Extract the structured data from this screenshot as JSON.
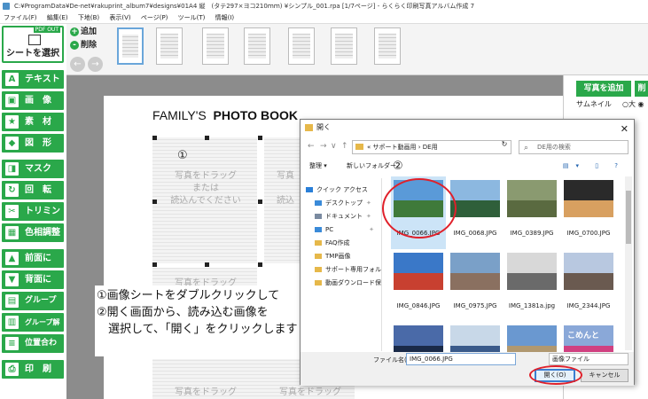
{
  "window": {
    "title": "C:¥ProgramData¥De-net¥rakuprint_album7¥designs¥01A4 縦　(タテ297×ヨコ210ｍｍ) ¥シンプル_001.rpa [1/7ページ] - らくらく印刷写真アルバム作成 7"
  },
  "menu": [
    "ファイル(F)",
    "編集(E)",
    "下地(B)",
    "表示(V)",
    "ページ(P)",
    "ツール(T)",
    "情報(I)"
  ],
  "left_tools": {
    "sheet_badge": "PDF OUT",
    "sheet_label": "シートを選択",
    "items": [
      {
        "label": "テキスト",
        "icon": "A"
      },
      {
        "label": "画　像",
        "icon": "▣"
      },
      {
        "label": "素　材",
        "icon": "★"
      },
      {
        "label": "図　形",
        "icon": "◆"
      },
      {
        "label": "マスク",
        "icon": "◨"
      },
      {
        "label": "回　転",
        "icon": "↻"
      },
      {
        "label": "トリミング",
        "icon": "✂"
      },
      {
        "label": "色相調整",
        "icon": "▦"
      },
      {
        "label": "前面に",
        "icon": "▲"
      },
      {
        "label": "背面に",
        "icon": "▼"
      },
      {
        "label": "グループ化",
        "icon": "▤"
      },
      {
        "label": "グループ解除",
        "icon": "▥"
      },
      {
        "label": "位置合わせ",
        "icon": "≡"
      },
      {
        "label": "印　刷",
        "icon": "⎙"
      }
    ]
  },
  "page_bar": {
    "add_label": "追加",
    "delete_label": "削除",
    "add_icon": "+",
    "delete_icon": "-",
    "prev_icon": "←",
    "next_icon": "→"
  },
  "canvas": {
    "title_regular": "FAMILY'S",
    "title_bold": "PHOTO BOOK",
    "marker_1": "①",
    "placeholder_line1": "写真をドラッグ",
    "placeholder_line2": "または",
    "placeholder_line3": "読込んでください",
    "placeholder_partial2": "写真",
    "placeholder_partial3": "読込",
    "placeholder_drag": "写真をドラッグ"
  },
  "right_panel": {
    "add_photo_label": "写真を追加",
    "partial_label": "削",
    "thumb_size_label": "サムネイル",
    "size_option": "○大 ◉"
  },
  "instructions": {
    "line1": "①画像シートをダブルクリックして",
    "line2": "②開く画面から、読み込む画像を",
    "line3": "　選択して、「開く」をクリックします"
  },
  "dialog": {
    "title": "開く",
    "close_icon": "✕",
    "back_icon": "←",
    "forward_icon": "→",
    "dropdown_icon": "∨",
    "up_icon": "↑",
    "path": "«  サポート動画用  ›  DE用",
    "refresh_icon": "↻",
    "search_icon": "⌕",
    "search_placeholder": "DE用の検索",
    "organize_label": "整理 ▾",
    "new_folder_label": "新しいフォルダー",
    "view_icons": "▤▾ ▯ ?",
    "marker_2": "②",
    "nav": [
      {
        "label": "クイック アクセス",
        "pin": "",
        "color": "#2a7fd8"
      },
      {
        "label": "デスクトップ",
        "pin": "✦",
        "color": "#3a8ad8"
      },
      {
        "label": "ドキュメント",
        "pin": "✦",
        "color": "#7a8aa0"
      },
      {
        "label": "PC",
        "pin": "✦",
        "color": "#3a8ad8"
      },
      {
        "label": "FAQ作成",
        "pin": "",
        "color": "#e6b84a"
      },
      {
        "label": "TMP画像",
        "pin": "",
        "color": "#e6b84a"
      },
      {
        "label": "サポート専用フォル",
        "pin": "",
        "color": "#e6b84a"
      },
      {
        "label": "動画ダウンロード保",
        "pin": "",
        "color": "#e6b84a"
      }
    ],
    "files": [
      {
        "name": "IMG_0066.JPG",
        "c1": "#5a9ad8",
        "c2": "#3f7a3a"
      },
      {
        "name": "IMG_0068.JPG",
        "c1": "#8cb8e0",
        "c2": "#2f5f3a"
      },
      {
        "name": "IMG_0389.JPG",
        "c1": "#8a9a70",
        "c2": "#5a6a40"
      },
      {
        "name": "IMG_0700.JPG",
        "c1": "#2a2a2a",
        "c2": "#d8a060"
      },
      {
        "name": "IMG_0846.JPG",
        "c1": "#3a78c8",
        "c2": "#c84030"
      },
      {
        "name": "IMG_0975.JPG",
        "c1": "#7aa0c8",
        "c2": "#8a7060"
      },
      {
        "name": "IMG_1381a.jpg",
        "c1": "#d8d8d8",
        "c2": "#6a6a6a"
      },
      {
        "name": "IMG_2344.JPG",
        "c1": "#b8c8e0",
        "c2": "#6a5a50"
      },
      {
        "name": "",
        "c1": "#4a6aa8",
        "c2": "#1a2a48"
      },
      {
        "name": "",
        "c1": "#c8d8e8",
        "c2": "#3a5a8a"
      },
      {
        "name": "",
        "c1": "#6a98d0",
        "c2": "#b09870"
      },
      {
        "name": "",
        "c1": "#8aa8d8",
        "c2": "#d04080"
      }
    ],
    "file_caption": "こめんと",
    "filename_label": "ファイル名(N):",
    "filename_value": "IMG_0066.JPG",
    "filetype_value": "画像ファイル",
    "open_label": "開く(O)",
    "cancel_label": "キャンセル"
  },
  "colors": {
    "accent_green": "#2aa84a",
    "highlight_red": "#e0202a",
    "workarea_gray": "#8c8c8c"
  }
}
